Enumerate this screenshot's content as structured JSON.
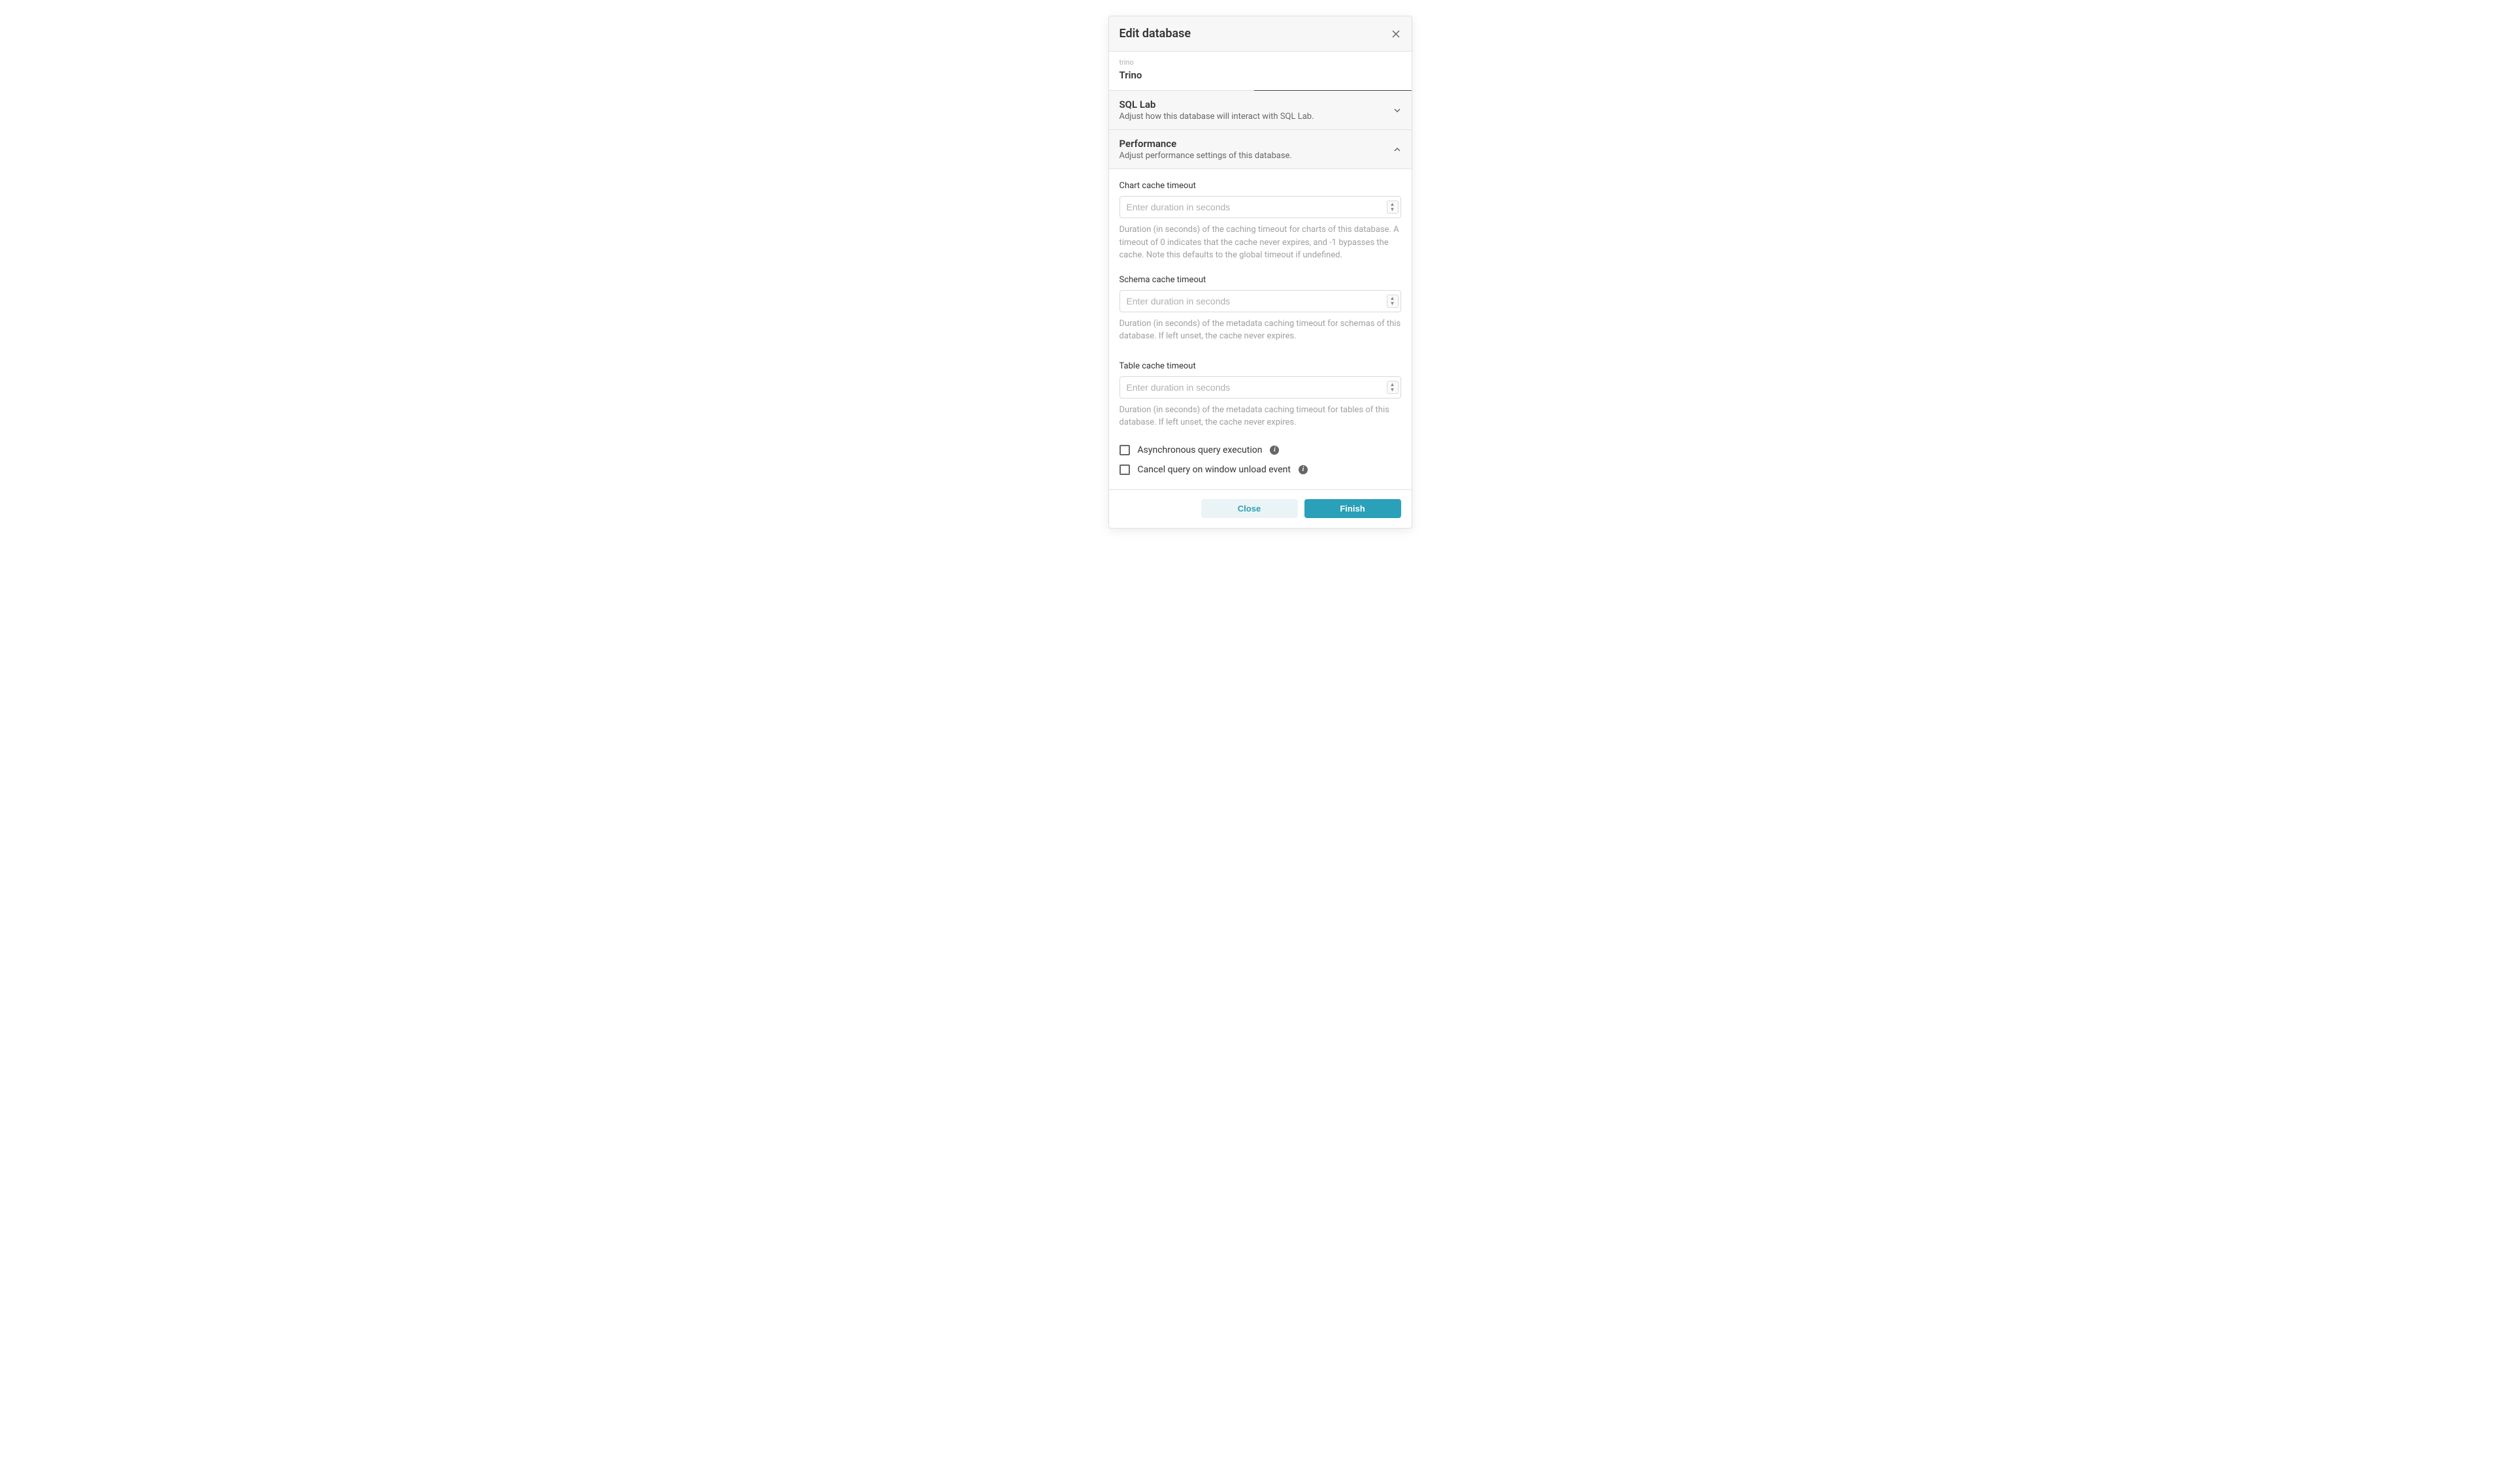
{
  "modal": {
    "title": "Edit database"
  },
  "database": {
    "type_slug": "trino",
    "name": "Trino"
  },
  "sections": {
    "sql_lab": {
      "title": "SQL Lab",
      "subtitle": "Adjust how this database will interact with SQL Lab."
    },
    "performance": {
      "title": "Performance",
      "subtitle": "Adjust performance settings of this database."
    }
  },
  "fields": {
    "chart_cache": {
      "label": "Chart cache timeout",
      "placeholder": "Enter duration in seconds",
      "help": "Duration (in seconds) of the caching timeout for charts of this database. A timeout of 0 indicates that the cache never expires, and -1 bypasses the cache. Note this defaults to the global timeout if undefined."
    },
    "schema_cache": {
      "label": "Schema cache timeout",
      "placeholder": "Enter duration in seconds",
      "help": "Duration (in seconds) of the metadata caching timeout for schemas of this database. If left unset, the cache never expires."
    },
    "table_cache": {
      "label": "Table cache timeout",
      "placeholder": "Enter duration in seconds",
      "help": "Duration (in seconds) of the metadata caching timeout for tables of this database. If left unset, the cache never expires."
    },
    "async_exec": {
      "label": "Asynchronous query execution"
    },
    "cancel_unload": {
      "label": "Cancel query on window unload event"
    }
  },
  "buttons": {
    "close": "Close",
    "finish": "Finish"
  }
}
